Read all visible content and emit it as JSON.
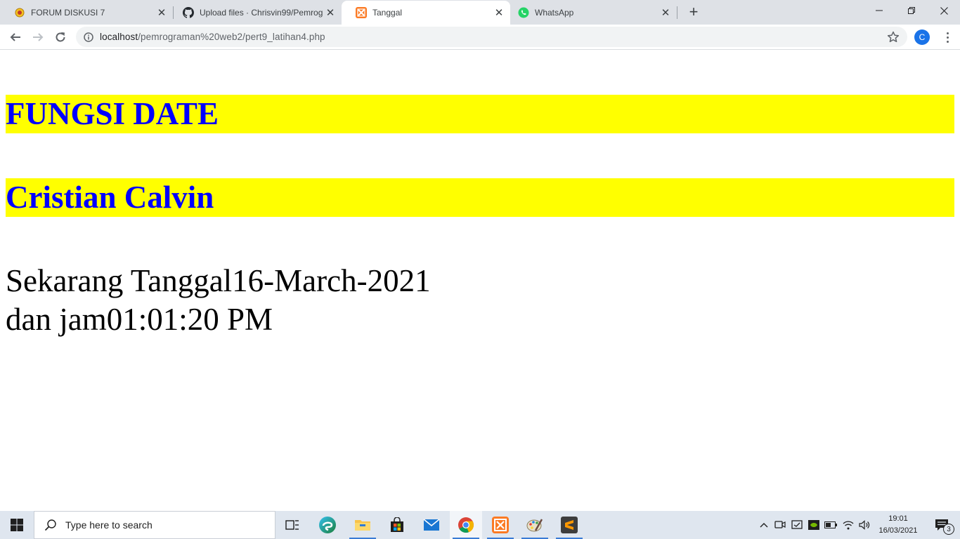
{
  "browser": {
    "tabs": [
      {
        "title": "FORUM DISKUSI 7",
        "icon": "forum-favicon-icon",
        "active": false
      },
      {
        "title": "Upload files · Chrisvin99/Pemrog",
        "icon": "github-icon",
        "active": false
      },
      {
        "title": "Tanggal",
        "icon": "xampp-icon",
        "active": true
      },
      {
        "title": "WhatsApp",
        "icon": "whatsapp-icon",
        "active": false
      }
    ],
    "url_host": "localhost",
    "url_path": "/pemrograman%20web2/pert9_latihan4.php",
    "profile_initial": "C"
  },
  "page": {
    "heading1": "FUNGSI DATE",
    "heading2": "Cristian Calvin",
    "date_line": "Sekarang Tanggal16-March-2021",
    "time_line": "dan jam01:01:20 PM",
    "colors": {
      "banner_bg": "#ffff00",
      "banner_text": "#0000ff"
    }
  },
  "taskbar": {
    "search_placeholder": "Type here to search",
    "time": "19:01",
    "date": "16/03/2021",
    "notification_count": "3"
  }
}
